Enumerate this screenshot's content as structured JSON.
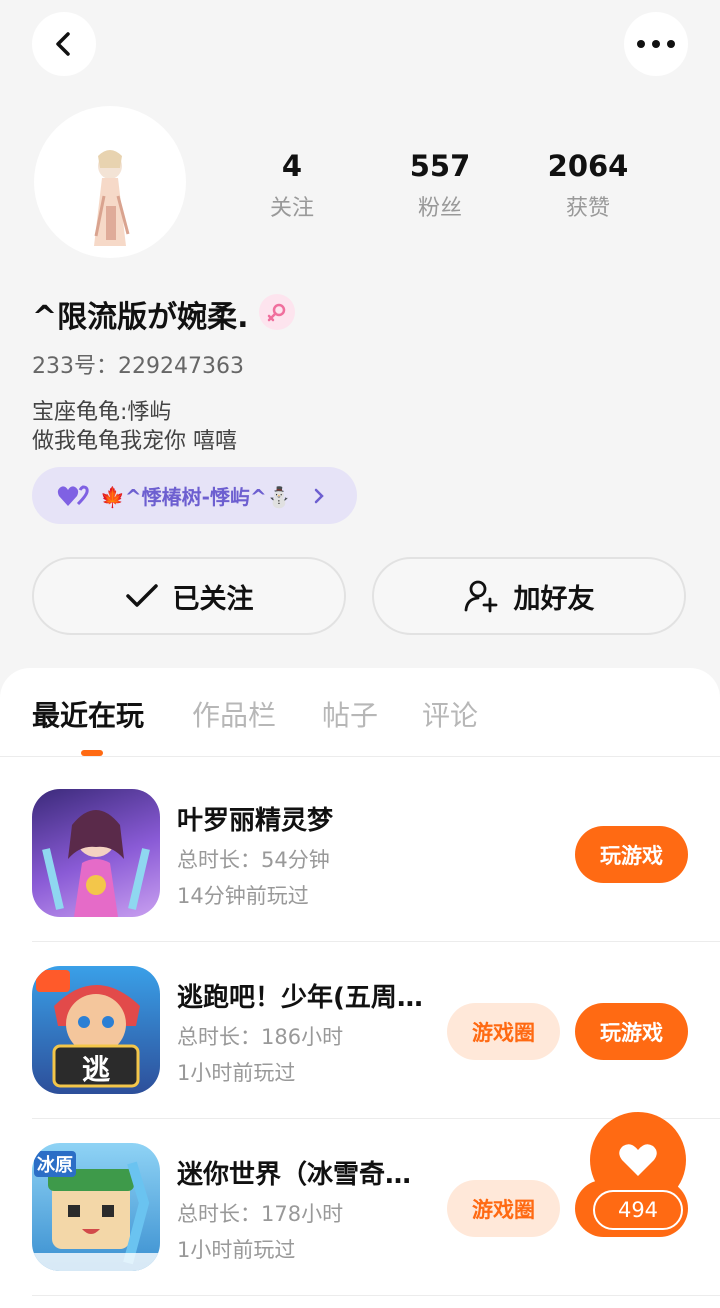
{
  "profile": {
    "stats": [
      {
        "num": "4",
        "label": "关注"
      },
      {
        "num": "557",
        "label": "粉丝"
      },
      {
        "num": "2064",
        "label": "获赞"
      }
    ],
    "nickname": "^限流版が婉柔.",
    "uid": "233号：229247363",
    "bio_line1": "宝座龟龟:悸屿",
    "bio_line2": "做我龟龟我宠你 嘻嘻",
    "relation_text": "🍁^悸椿树-悸屿^⛄",
    "follow_label": "已关注",
    "add_friend_label": "加好友"
  },
  "tabs": [
    "最近在玩",
    "作品栏",
    "帖子",
    "评论"
  ],
  "games": [
    {
      "name": "叶罗丽精灵梦",
      "duration": "总时长：54分钟",
      "last_played": "14分钟前玩过",
      "play_label": "玩游戏"
    },
    {
      "name": "逃跑吧！少年(五周…",
      "duration": "总时长：186小时",
      "last_played": "1小时前玩过",
      "circle_label": "游戏圈",
      "play_label": "玩游戏"
    },
    {
      "name": "迷你世界（冰雪奇…",
      "duration": "总时长：178小时",
      "last_played": "1小时前玩过",
      "circle_label": "游戏圈"
    }
  ],
  "icon_text": {
    "game2": "逃",
    "game3": "冰原"
  },
  "like_count": "494",
  "colors": {
    "accent": "#ff6a13",
    "accent_light": "#ffe8d9",
    "relation_bg": "#e6e3f7",
    "relation_text": "#6d5fd0"
  }
}
